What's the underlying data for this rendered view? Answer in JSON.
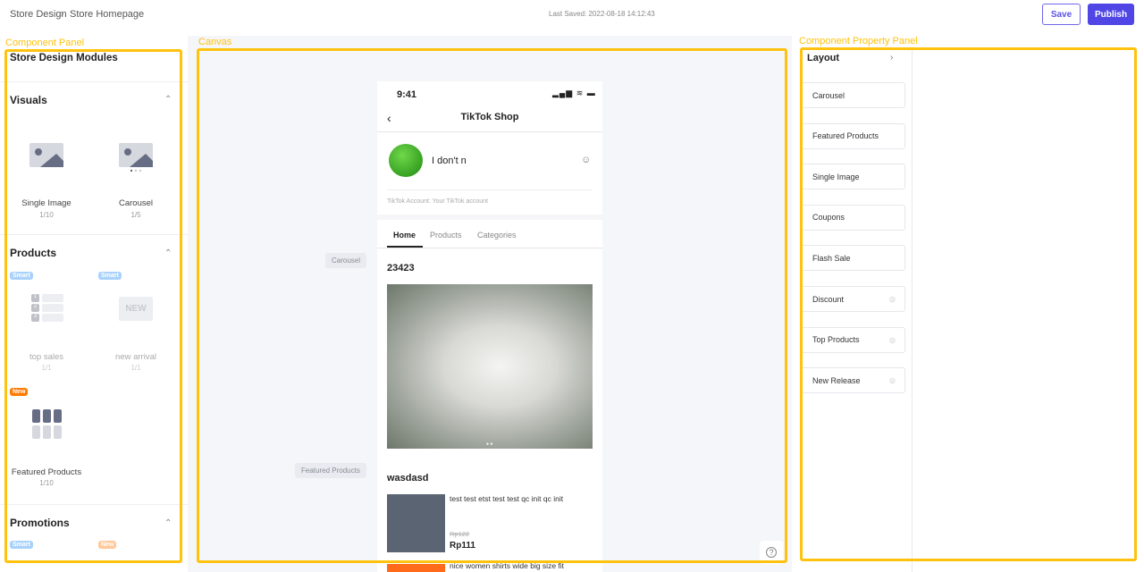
{
  "header": {
    "breadcrumb": [
      "Store Design",
      "Store Homepage"
    ],
    "last_saved": "Last Saved: 2022-08-18 14:12:43",
    "save_label": "Save",
    "publish_label": "Publish"
  },
  "annotations": {
    "component_panel": "Component Panel",
    "canvas": "Canvas",
    "property_panel": "Component Property Panel"
  },
  "left_panel": {
    "title": "Store Design Modules",
    "visuals": {
      "title": "Visuals",
      "modules": [
        {
          "label": "Single Image",
          "count": "1/10"
        },
        {
          "label": "Carousel",
          "count": "1/5"
        }
      ]
    },
    "products": {
      "title": "Products",
      "modules": [
        {
          "badge": "Smart",
          "label": "top sales",
          "count": "1/1"
        },
        {
          "badge": "Smart",
          "label": "new arrival",
          "count": "1/1",
          "icon_text": "NEW"
        },
        {
          "badge": "New",
          "label": "Featured Products",
          "count": "1/10"
        }
      ],
      "rank_numbers": [
        "1",
        "2",
        "3"
      ]
    },
    "promotions": {
      "title": "Promotions",
      "badges": [
        "Smart",
        "New"
      ]
    }
  },
  "canvas": {
    "tags": [
      "Carousel",
      "Featured Products"
    ],
    "phone": {
      "time": "9:41",
      "title": "TikTok Shop",
      "shop_name": "I don't n",
      "account": "TikTok Account: Your TikTok account",
      "tabs": [
        "Home",
        "Products",
        "Categories"
      ],
      "active_tab": "Home",
      "carousel_title": "23423",
      "featured_title": "wasdasd",
      "products": [
        {
          "name": "test test etst test test qc init qc init",
          "old_price": "Rp122",
          "price": "Rp111"
        },
        {
          "name": "nice women shirts wide big size fit"
        }
      ]
    }
  },
  "property_panel": {
    "title": "Layout",
    "items": [
      {
        "label": "Carousel",
        "hidden": false
      },
      {
        "label": "Featured Products",
        "hidden": false
      },
      {
        "label": "Single Image",
        "hidden": false
      },
      {
        "label": "Coupons",
        "hidden": false
      },
      {
        "label": "Flash Sale",
        "hidden": false
      },
      {
        "label": "Discount",
        "hidden": true
      },
      {
        "label": "Top Products",
        "hidden": true
      },
      {
        "label": "New Release",
        "hidden": true
      }
    ]
  },
  "colors": {
    "accent": "#4f46e5",
    "annotation": "#ffc20e",
    "badge_smart": "#a9d2fb",
    "badge_new": "#ff7a00"
  }
}
